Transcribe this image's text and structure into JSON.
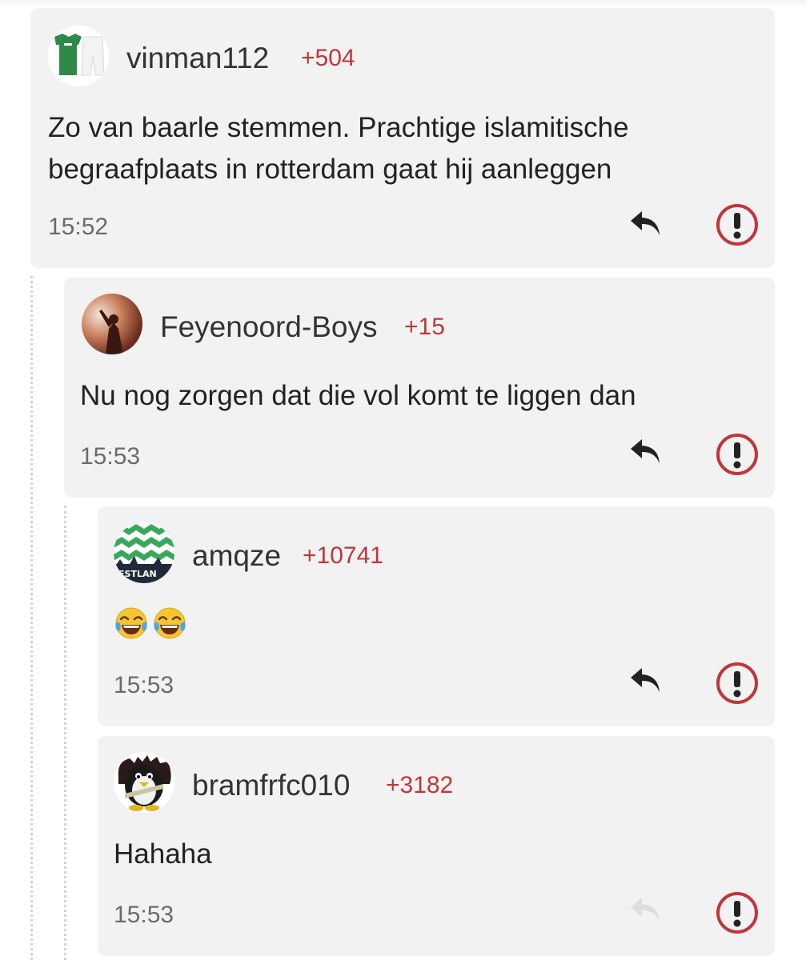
{
  "comments": [
    {
      "username": "vinman112",
      "score": "+504",
      "text_lines": [
        "Zo van baarle stemmen. Prachtige islamitische",
        "begraafplaats in rotterdam gaat hij aanleggen"
      ],
      "time": "15:52",
      "avatar_icon": "green-kit-avatar",
      "reply_enabled": true
    },
    {
      "username": "Feyenoord-Boys",
      "score": "+15",
      "text_lines": [
        "Nu nog zorgen dat die vol komt te liggen dan"
      ],
      "time": "15:53",
      "avatar_icon": "flare-photo-avatar",
      "reply_enabled": true
    },
    {
      "username": "amqze",
      "score": "+10741",
      "text_lines": [],
      "emoji": [
        "face-with-tears-of-joy",
        "face-with-tears-of-joy"
      ],
      "time": "15:53",
      "avatar_icon": "green-chevron-avatar",
      "reply_enabled": true
    },
    {
      "username": "bramfrfc010",
      "score": "+3182",
      "text_lines": [
        "Hahaha"
      ],
      "time": "15:53",
      "avatar_icon": "penguin-avatar",
      "reply_enabled": false
    }
  ],
  "colors": {
    "score": "#c0363a",
    "report": "#c0363a",
    "card": "#f2f2f2",
    "reply_active": "#222222",
    "reply_disabled": "#dddddd"
  },
  "icons": {
    "reply": "reply-arrow-icon",
    "report": "report-exclamation-icon"
  }
}
